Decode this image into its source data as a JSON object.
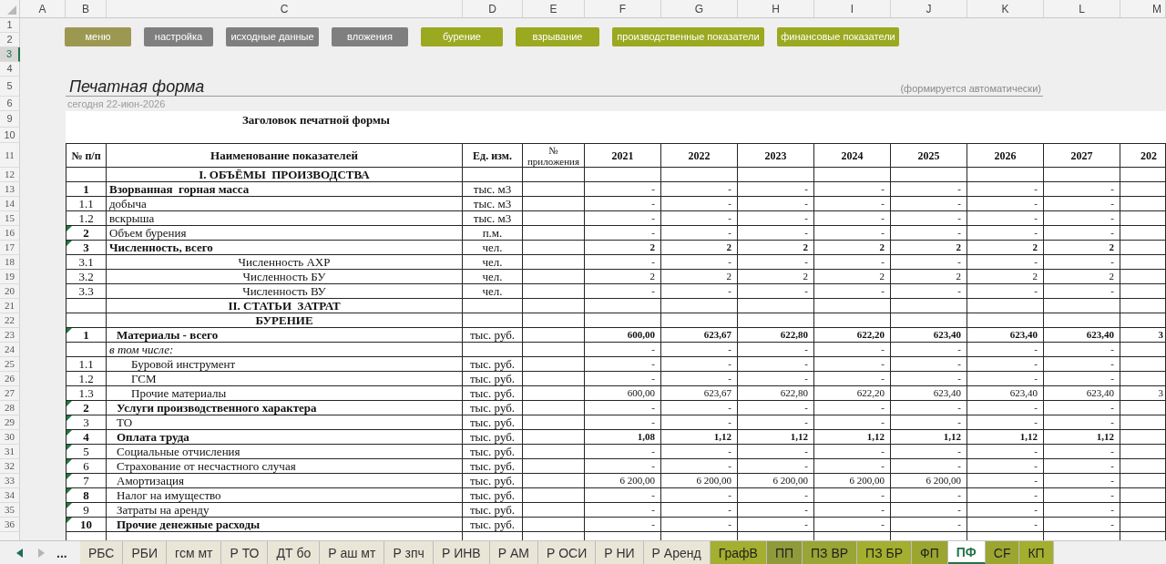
{
  "sheet": {
    "column_headers": [
      "A",
      "B",
      "C",
      "D",
      "E",
      "F",
      "G",
      "H",
      "I",
      "J",
      "K",
      "L",
      "M"
    ],
    "row_headers": [
      {
        "label": "1",
        "selected": false
      },
      {
        "label": "2",
        "selected": false
      },
      {
        "label": "3",
        "selected": true
      },
      {
        "label": "4",
        "selected": false
      },
      {
        "label": "5",
        "selected": false
      },
      {
        "label": "6",
        "selected": false
      },
      {
        "label": "9",
        "selected": false
      },
      {
        "label": "10",
        "selected": false
      },
      {
        "label": "11",
        "selected": false
      },
      {
        "label": "12",
        "selected": false
      },
      {
        "label": "13",
        "selected": false
      },
      {
        "label": "14",
        "selected": false
      },
      {
        "label": "15",
        "selected": false
      },
      {
        "label": "16",
        "selected": false
      },
      {
        "label": "17",
        "selected": false
      },
      {
        "label": "18",
        "selected": false
      },
      {
        "label": "19",
        "selected": false
      },
      {
        "label": "20",
        "selected": false
      },
      {
        "label": "21",
        "selected": false
      },
      {
        "label": "22",
        "selected": false
      },
      {
        "label": "23",
        "selected": false
      },
      {
        "label": "24",
        "selected": false
      },
      {
        "label": "25",
        "selected": false
      },
      {
        "label": "26",
        "selected": false
      },
      {
        "label": "27",
        "selected": false
      },
      {
        "label": "28",
        "selected": false
      },
      {
        "label": "29",
        "selected": false
      },
      {
        "label": "30",
        "selected": false
      },
      {
        "label": "31",
        "selected": false
      },
      {
        "label": "32",
        "selected": false
      },
      {
        "label": "33",
        "selected": false
      },
      {
        "label": "34",
        "selected": false
      },
      {
        "label": "35",
        "selected": false
      },
      {
        "label": "36",
        "selected": false
      }
    ]
  },
  "buttons": [
    {
      "label": "меню",
      "color": "#9c9852"
    },
    {
      "label": "настройка",
      "color": "#7f7f7f"
    },
    {
      "label": "исходные данные",
      "color": "#7f7f7f"
    },
    {
      "label": "вложения",
      "color": "#7f7f7f"
    },
    {
      "label": "бурение",
      "color": "#9aa91f"
    },
    {
      "label": "взрывание",
      "color": "#9aa91f"
    },
    {
      "label": "производственные показатели",
      "color": "#9aa91f"
    },
    {
      "label": "финансовые показатели",
      "color": "#9aa91f"
    }
  ],
  "title": "Печатная форма",
  "note": "(формируется автоматически)",
  "date": "сегодня 22-июн-2026",
  "form_heading": "Заголовок печатной формы",
  "table": {
    "columns": [
      "№ п/п",
      "Наименование показателей",
      "Ед. изм.",
      "№ приложения"
    ],
    "years": [
      "2021",
      "2022",
      "2023",
      "2024",
      "2025",
      "2026",
      "2027",
      "202"
    ],
    "rows": [
      {
        "kind": "heading",
        "name": "I. ОБЪЁМЫ  ПРОИЗВОДСТВА",
        "marker": false
      },
      {
        "kind": "plain",
        "number": "1",
        "name": "Взорванная  горная масса",
        "unit": "тыс. м3",
        "values": [
          "-",
          "-",
          "-",
          "-",
          "-",
          "-",
          "-"
        ],
        "number_bold": true,
        "name_bold": true,
        "values_bold": false,
        "marker": false
      },
      {
        "kind": "plain",
        "number": "1.1",
        "name": "добыча",
        "unit": "тыс. м3",
        "values": [
          "-",
          "-",
          "-",
          "-",
          "-",
          "-",
          "-"
        ],
        "number_bold": false,
        "name_bold": false,
        "values_bold": false,
        "marker": false
      },
      {
        "kind": "plain",
        "number": "1.2",
        "name": "вскрыша",
        "unit": "тыс. м3",
        "values": [
          "-",
          "-",
          "-",
          "-",
          "-",
          "-",
          "-"
        ],
        "number_bold": false,
        "name_bold": false,
        "values_bold": false,
        "marker": false
      },
      {
        "kind": "plain",
        "number": "2",
        "name": "Объем бурения",
        "unit": "п.м.",
        "values": [
          "-",
          "-",
          "-",
          "-",
          "-",
          "-",
          "-"
        ],
        "number_bold": true,
        "name_bold": false,
        "values_bold": false,
        "marker": true
      },
      {
        "kind": "plain",
        "number": "3",
        "name": "Численность, всего",
        "unit": "чел.",
        "values": [
          "2",
          "2",
          "2",
          "2",
          "2",
          "2",
          "2"
        ],
        "number_bold": true,
        "name_bold": true,
        "values_bold": true,
        "marker": true
      },
      {
        "kind": "centered",
        "number": "3.1",
        "name": "Численность АХР",
        "unit": "чел.",
        "values": [
          "-",
          "-",
          "-",
          "-",
          "-",
          "-",
          "-"
        ],
        "number_bold": false,
        "name_bold": false,
        "values_bold": false,
        "marker": false
      },
      {
        "kind": "centered",
        "number": "3.2",
        "name": "Численность БУ",
        "unit": "чел.",
        "values": [
          "2",
          "2",
          "2",
          "2",
          "2",
          "2",
          "2"
        ],
        "number_bold": false,
        "name_bold": false,
        "values_bold": false,
        "marker": false
      },
      {
        "kind": "centered",
        "number": "3.3",
        "name": "Численность ВУ",
        "unit": "чел.",
        "values": [
          "-",
          "-",
          "-",
          "-",
          "-",
          "-",
          "-"
        ],
        "number_bold": false,
        "name_bold": false,
        "values_bold": false,
        "marker": false
      },
      {
        "kind": "heading",
        "name": "II. СТАТЬИ  ЗАТРАТ",
        "marker": false
      },
      {
        "kind": "heading",
        "name": "БУРЕНИЕ",
        "marker": false
      },
      {
        "kind": "indented",
        "number": "1",
        "name": "Материалы - всего",
        "unit": "тыс. руб.",
        "values": [
          "600,00",
          "623,67",
          "622,80",
          "622,20",
          "623,40",
          "623,40",
          "623,40"
        ],
        "col_m": "3",
        "number_bold": true,
        "name_bold": true,
        "values_bold": true,
        "marker": true
      },
      {
        "kind": "note",
        "name": "в том числе:",
        "values": [
          "-",
          "-",
          "-",
          "-",
          "-",
          "-",
          "-"
        ],
        "values_bold": false,
        "marker": false
      },
      {
        "kind": "subitem",
        "number": "1.1",
        "name": "Буровой инструмент",
        "unit": "тыс. руб.",
        "values": [
          "-",
          "-",
          "-",
          "-",
          "-",
          "-",
          "-"
        ],
        "number_bold": false,
        "name_bold": false,
        "values_bold": false,
        "marker": false
      },
      {
        "kind": "subitem",
        "number": "1.2",
        "name": "ГСМ",
        "unit": "тыс. руб.",
        "values": [
          "-",
          "-",
          "-",
          "-",
          "-",
          "-",
          "-"
        ],
        "number_bold": false,
        "name_bold": false,
        "values_bold": false,
        "marker": false
      },
      {
        "kind": "subitem",
        "number": "1.3",
        "name": "Прочие материалы",
        "unit": "тыс. руб.",
        "values": [
          "600,00",
          "623,67",
          "622,80",
          "622,20",
          "623,40",
          "623,40",
          "623,40"
        ],
        "col_m": "3",
        "number_bold": false,
        "name_bold": false,
        "values_bold": false,
        "marker": false
      },
      {
        "kind": "indented",
        "number": "2",
        "name": "Услуги производственного характера",
        "unit": "тыс. руб.",
        "values": [
          "-",
          "-",
          "-",
          "-",
          "-",
          "-",
          "-"
        ],
        "number_bold": true,
        "name_bold": true,
        "values_bold": false,
        "marker": true
      },
      {
        "kind": "indented",
        "number": "3",
        "name": "ТО",
        "unit": "тыс. руб.",
        "values": [
          "-",
          "-",
          "-",
          "-",
          "-",
          "-",
          "-"
        ],
        "number_bold": false,
        "name_bold": false,
        "values_bold": false,
        "marker": true
      },
      {
        "kind": "indented",
        "number": "4",
        "name": "Оплата труда",
        "unit": "тыс. руб.",
        "values": [
          "1,08",
          "1,12",
          "1,12",
          "1,12",
          "1,12",
          "1,12",
          "1,12"
        ],
        "number_bold": true,
        "name_bold": true,
        "values_bold": true,
        "marker": true
      },
      {
        "kind": "indented",
        "number": "5",
        "name": "Социальные отчисления",
        "unit": "тыс. руб.",
        "values": [
          "-",
          "-",
          "-",
          "-",
          "-",
          "-",
          "-"
        ],
        "number_bold": false,
        "name_bold": false,
        "values_bold": false,
        "marker": true
      },
      {
        "kind": "indented",
        "number": "6",
        "name": "Страхование от несчастного случая",
        "unit": "тыс. руб.",
        "values": [
          "-",
          "-",
          "-",
          "-",
          "-",
          "-",
          "-"
        ],
        "number_bold": false,
        "name_bold": false,
        "values_bold": false,
        "marker": true
      },
      {
        "kind": "indented",
        "number": "7",
        "name": "Амортизация",
        "unit": "тыс. руб.",
        "values": [
          "6 200,00",
          "6 200,00",
          "6 200,00",
          "6 200,00",
          "6 200,00",
          "-",
          "-"
        ],
        "number_bold": false,
        "name_bold": false,
        "values_bold": false,
        "marker": true
      },
      {
        "kind": "indented",
        "number": "8",
        "name": "Налог на имущество",
        "unit": "тыс. руб.",
        "values": [
          "-",
          "-",
          "-",
          "-",
          "-",
          "-",
          "-"
        ],
        "number_bold": true,
        "name_bold": false,
        "values_bold": false,
        "marker": true
      },
      {
        "kind": "indented",
        "number": "9",
        "name": "Затраты на аренду",
        "unit": "тыс. руб.",
        "values": [
          "-",
          "-",
          "-",
          "-",
          "-",
          "-",
          "-"
        ],
        "number_bold": false,
        "name_bold": false,
        "values_bold": false,
        "marker": true
      },
      {
        "kind": "indented",
        "number": "10",
        "name": "Прочие денежные расходы",
        "unit": "тыс. руб.",
        "values": [
          "-",
          "-",
          "-",
          "-",
          "-",
          "-",
          "-"
        ],
        "number_bold": true,
        "name_bold": true,
        "values_bold": false,
        "marker": true
      }
    ]
  },
  "sheet_tabs": {
    "more": "...",
    "tabs": [
      {
        "label": "РБС",
        "selected": false
      },
      {
        "label": "РБИ",
        "selected": false
      },
      {
        "label": "гсм мт",
        "selected": false
      },
      {
        "label": "Р ТО",
        "selected": false
      },
      {
        "label": "ДТ бо",
        "selected": false
      },
      {
        "label": "Р аш мт",
        "selected": false
      },
      {
        "label": "Р зпч",
        "selected": false
      },
      {
        "label": "Р ИНВ",
        "selected": false
      },
      {
        "label": "Р АМ",
        "selected": false
      },
      {
        "label": "Р ОСИ",
        "selected": false
      },
      {
        "label": "Р НИ",
        "selected": false
      },
      {
        "label": "Р Аренд",
        "selected": false
      },
      {
        "label": "ГрафВ",
        "selected": false,
        "color": "#a4ae2f"
      },
      {
        "label": "ПП",
        "selected": false,
        "color": "#8f9a3b"
      },
      {
        "label": "ПЗ ВР",
        "selected": false,
        "color": "#99a535"
      },
      {
        "label": "ПЗ БР",
        "selected": false,
        "color": "#a4ae2f"
      },
      {
        "label": "ФП",
        "selected": false,
        "color": "#9aa630"
      },
      {
        "label": "ПФ",
        "selected": true
      },
      {
        "label": "CF",
        "selected": false,
        "color": "#9aa630"
      },
      {
        "label": "КП",
        "selected": false,
        "color": "#a4ae2f"
      }
    ]
  }
}
